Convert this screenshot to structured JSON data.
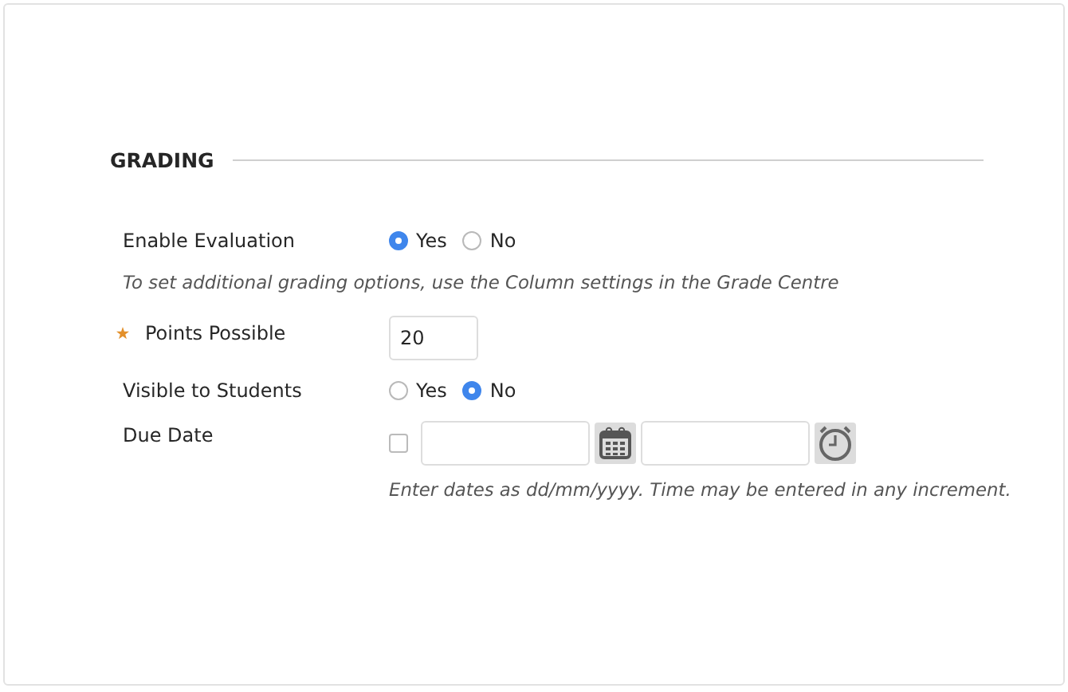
{
  "section": {
    "title": "GRADING"
  },
  "enable_evaluation": {
    "label": "Enable Evaluation",
    "options": [
      {
        "label": "Yes",
        "selected": true
      },
      {
        "label": "No",
        "selected": false
      }
    ]
  },
  "hint": "To set additional grading options, use the Column settings in the Grade Centre",
  "points_possible": {
    "label": "Points Possible",
    "required": true,
    "value": "20"
  },
  "visible_to_students": {
    "label": "Visible to Students",
    "options": [
      {
        "label": "Yes",
        "selected": false
      },
      {
        "label": "No",
        "selected": true
      }
    ]
  },
  "due_date": {
    "label": "Due Date",
    "checked": false,
    "hint": "Enter dates as dd/mm/yyyy. Time may be entered in any increment."
  }
}
